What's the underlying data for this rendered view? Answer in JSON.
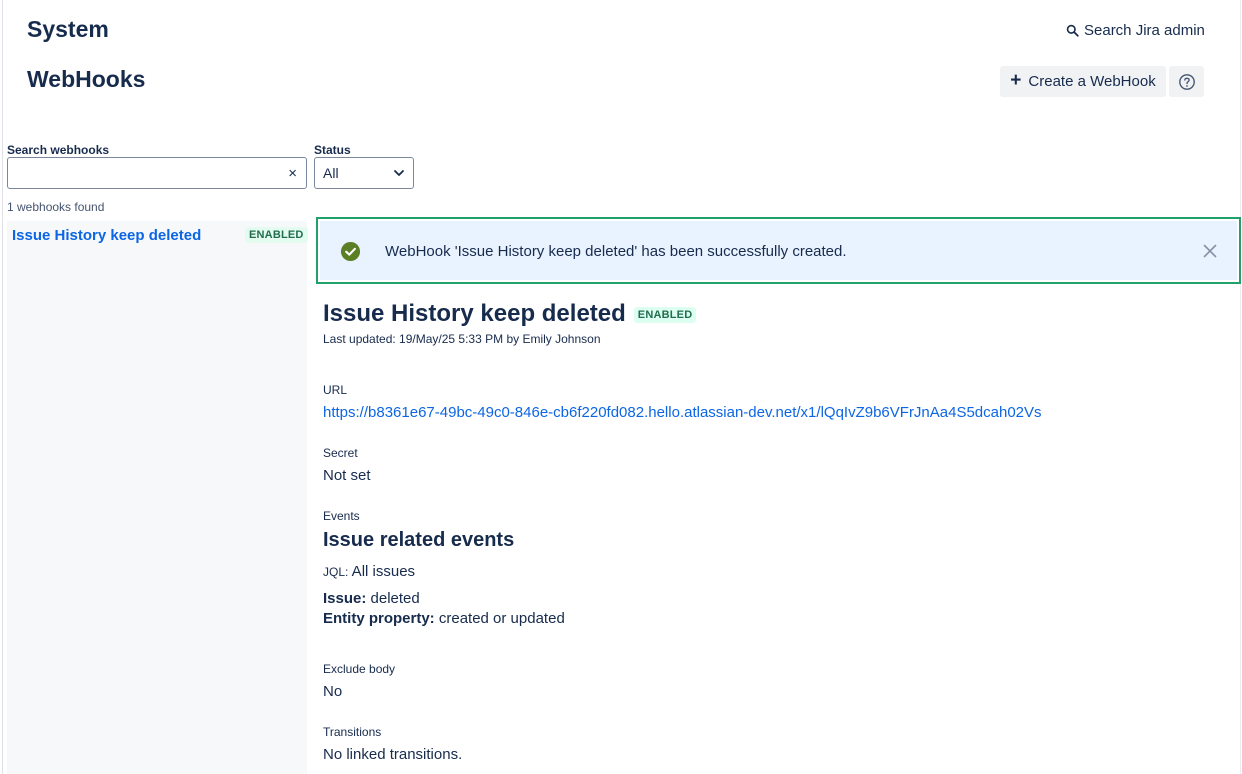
{
  "header": {
    "breadcrumb": "System",
    "title": "WebHooks",
    "search_admin_label": "Search Jira admin",
    "create_label": "Create a WebHook"
  },
  "filters": {
    "search_label": "Search webhooks",
    "search_value": "",
    "search_placeholder": "",
    "clear_glyph": "×",
    "status_label": "Status",
    "status_value": "All"
  },
  "results": {
    "count_text": "1 webhooks found",
    "items": [
      {
        "name": "Issue History keep deleted",
        "status": "ENABLED"
      }
    ]
  },
  "flag": {
    "message": "WebHook 'Issue History keep deleted' has been successfully created.",
    "type": "success"
  },
  "detail": {
    "name": "Issue History keep deleted",
    "status": "ENABLED",
    "last_updated": "Last updated: 19/May/25 5:33 PM by Emily Johnson",
    "url_label": "URL",
    "url": "https://b8361e67-49bc-49c0-846e-cb6f220fd082.hello.atlassian-dev.net/x1/lQqIvZ9b6VFrJnAa4S5dcah02Vs",
    "secret_label": "Secret",
    "secret_value": "Not set",
    "events_label": "Events",
    "events_heading": "Issue related events",
    "jql_key": "JQL:",
    "jql_value": " All issues",
    "issue_key": "Issue:",
    "issue_value": " deleted",
    "entity_key": "Entity property:",
    "entity_value": " created or updated",
    "exclude_label": "Exclude body",
    "exclude_value": "No",
    "transitions_label": "Transitions",
    "transitions_value": "No linked transitions."
  },
  "colors": {
    "link": "#0c66e4",
    "success": "#22a06b",
    "flag_bg": "#e9f2ff",
    "badge_bg": "#dcfff1",
    "badge_text": "#216e4e"
  },
  "icons": {
    "search": "search-icon",
    "plus": "plus-icon",
    "help": "help-icon",
    "chevron": "chevron-down-icon",
    "success": "check-circle-icon",
    "close": "close-icon"
  }
}
